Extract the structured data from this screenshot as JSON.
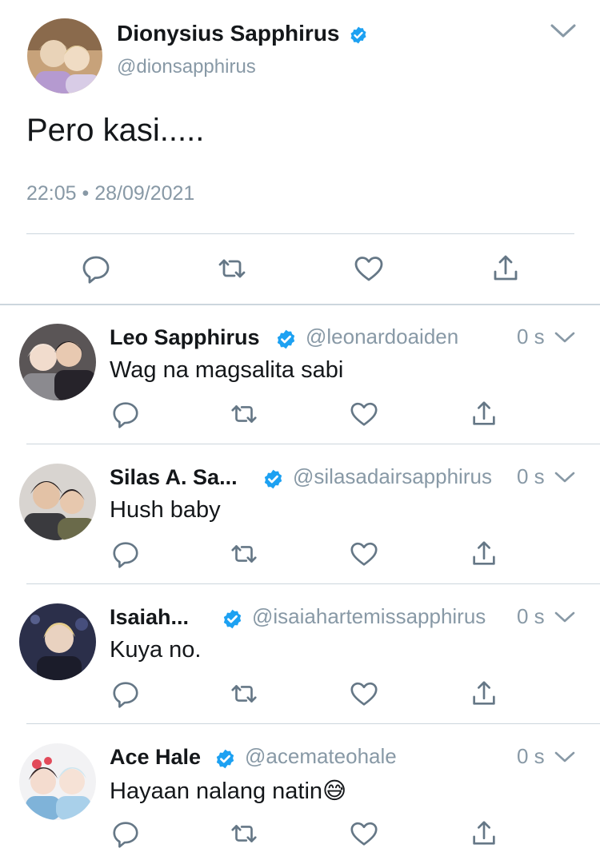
{
  "main_tweet": {
    "name": "Dionysius Sapphirus",
    "handle": "@dionsapphirus",
    "text": "Pero kasi.....",
    "timestamp": "22:05 • 28/09/2021",
    "icons": [
      "reply-icon",
      "retweet-icon",
      "like-icon",
      "share-icon"
    ]
  },
  "replies": [
    {
      "name": "Leo Sapphirus",
      "handle": "@leonardoaiden",
      "time": "0 s",
      "text": "Wag na magsalita sabi"
    },
    {
      "name": "Silas A. Sa...",
      "handle": "@silasadairsapphirus",
      "time": "0 s",
      "text": "Hush baby"
    },
    {
      "name": "Isaiah...",
      "handle": "@isaiahartemissapphirus",
      "time": "0 s",
      "text": "Kuya no."
    },
    {
      "name": "Ace Hale",
      "handle": "@acemateohale",
      "time": "0 s",
      "text": "Hayaan nalang natin",
      "emoji": "😅"
    }
  ],
  "colors": {
    "verified": "#1da1f2",
    "secondary_text": "#8899a6",
    "icon": "#657786",
    "divider": "#ccd6dd"
  }
}
